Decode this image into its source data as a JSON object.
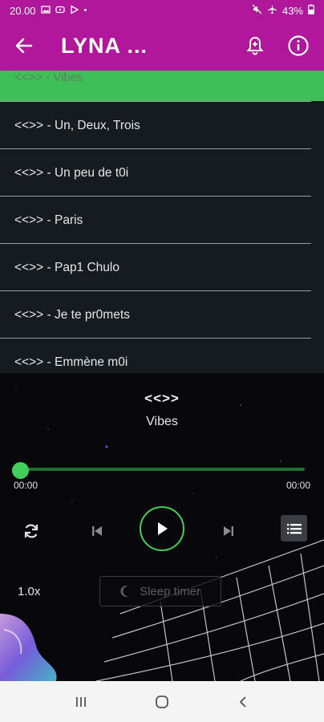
{
  "status_bar": {
    "time": "20.00",
    "battery": "43%",
    "left_icons": [
      "gallery-icon",
      "youtube-icon",
      "play-store-icon",
      "dot-icon"
    ],
    "right_icons": [
      "mute-icon",
      "airplane-icon",
      "battery-icon"
    ]
  },
  "app_bar": {
    "title": "LYNA ...",
    "background": "#b0179a"
  },
  "tracks": {
    "active": "<<>> - Vibes",
    "items": [
      "<<>> - Un, Deux, Trois",
      "<<>> - Un peu de t0i",
      "<<>> - Paris",
      "<<>> - Pap1 Chulo",
      "<<>> - Je te pr0mets",
      "<<>> - Emmène m0i"
    ]
  },
  "player": {
    "artist": "<<>>",
    "title": "Vibes",
    "current_time": "00:00",
    "total_time": "00:00",
    "progress": 0,
    "speed": "1.0x",
    "sleep_timer_label": "Sleep timer",
    "accent": "#3fcf5a"
  }
}
